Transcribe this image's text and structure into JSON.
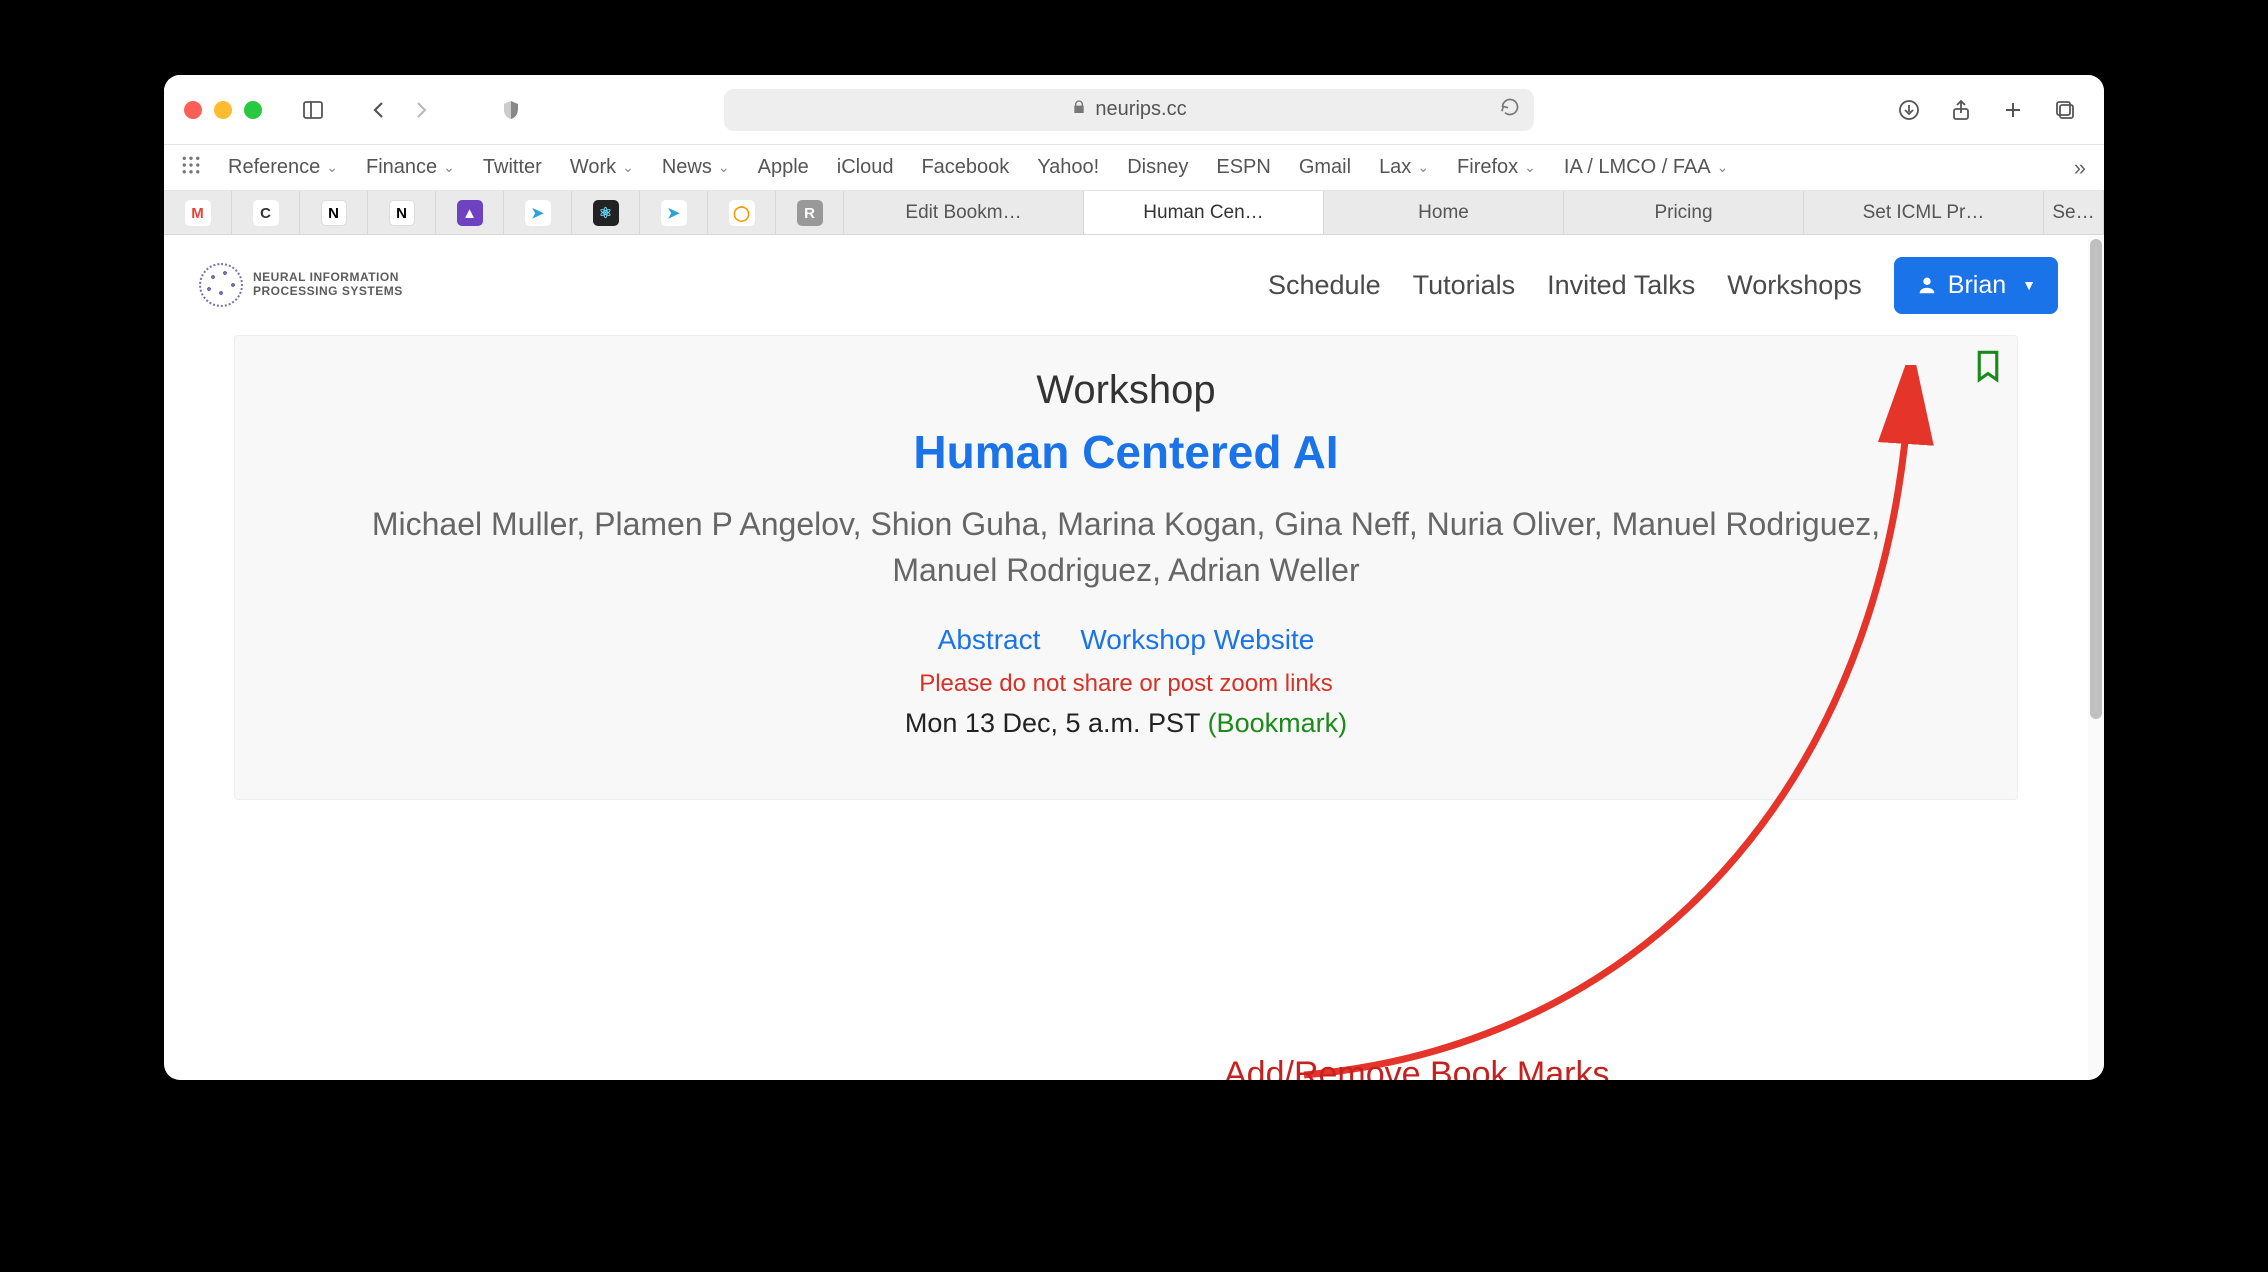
{
  "browser": {
    "url_host": "neurips.cc",
    "favorites": [
      {
        "label": "Reference",
        "dropdown": true
      },
      {
        "label": "Finance",
        "dropdown": true
      },
      {
        "label": "Twitter",
        "dropdown": false
      },
      {
        "label": "Work",
        "dropdown": true
      },
      {
        "label": "News",
        "dropdown": true
      },
      {
        "label": "Apple",
        "dropdown": false
      },
      {
        "label": "iCloud",
        "dropdown": false
      },
      {
        "label": "Facebook",
        "dropdown": false
      },
      {
        "label": "Yahoo!",
        "dropdown": false
      },
      {
        "label": "Disney",
        "dropdown": false
      },
      {
        "label": "ESPN",
        "dropdown": false
      },
      {
        "label": "Gmail",
        "dropdown": false
      },
      {
        "label": "Lax",
        "dropdown": true
      },
      {
        "label": "Firefox",
        "dropdown": true
      },
      {
        "label": "IA / LMCO / FAA",
        "dropdown": true
      }
    ],
    "pinned_tabs": [
      {
        "name": "gmail",
        "letter": "M",
        "bg": "#fff",
        "fg": "#ea4335"
      },
      {
        "name": "c-app",
        "letter": "C",
        "bg": "#fff",
        "fg": "#333"
      },
      {
        "name": "notion1",
        "letter": "N",
        "bg": "#fff",
        "fg": "#000"
      },
      {
        "name": "notion2",
        "letter": "N",
        "bg": "#fff",
        "fg": "#000"
      },
      {
        "name": "purple",
        "letter": "▲",
        "bg": "#6f42c1",
        "fg": "#fff"
      },
      {
        "name": "send1",
        "letter": "➤",
        "bg": "#fff",
        "fg": "#2aa3d8"
      },
      {
        "name": "react",
        "letter": "⚛",
        "bg": "#222",
        "fg": "#61dafb"
      },
      {
        "name": "send2",
        "letter": "➤",
        "bg": "#fff",
        "fg": "#2aa3d8"
      },
      {
        "name": "shield",
        "letter": "◯",
        "bg": "#fff",
        "fg": "#ff9500"
      },
      {
        "name": "r-app",
        "letter": "R",
        "bg": "#999",
        "fg": "#fff"
      }
    ],
    "tabs": [
      {
        "label": "Edit Bookm…",
        "active": false
      },
      {
        "label": "Human Cen…",
        "active": true
      },
      {
        "label": "Home",
        "active": false
      },
      {
        "label": "Pricing",
        "active": false
      },
      {
        "label": "Set ICML Pr…",
        "active": false
      },
      {
        "label": "Se…",
        "active": false,
        "narrow": true
      }
    ]
  },
  "site": {
    "logo_text_line1": "NEURAL INFORMATION",
    "logo_text_line2": "PROCESSING SYSTEMS",
    "nav_links": [
      "Schedule",
      "Tutorials",
      "Invited Talks",
      "Workshops"
    ],
    "user_name": "Brian"
  },
  "workshop": {
    "category": "Workshop",
    "title": "Human Centered AI",
    "authors": "Michael Muller, Plamen P Angelov, Shion Guha, Marina Kogan, Gina Neff, Nuria Oliver, Manuel Rodriguez, Manuel Rodriguez, Adrian Weller",
    "link_abstract": "Abstract",
    "link_website": "Workshop Website",
    "warning": "Please do not share or post zoom links",
    "schedule": "Mon 13 Dec, 5 a.m. PST",
    "bookmark_label": "(Bookmark)"
  },
  "annotation": {
    "label": "Add/Remove Book Marks"
  }
}
